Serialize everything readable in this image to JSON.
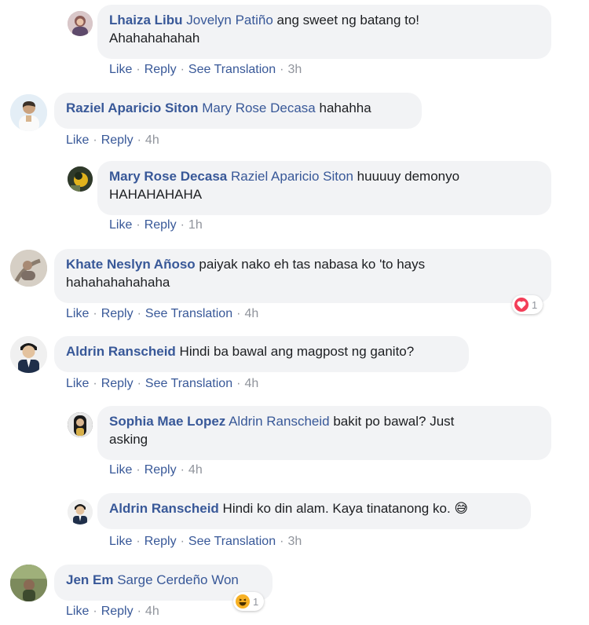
{
  "labels": {
    "like": "Like",
    "reply": "Reply",
    "see_translation": "See Translation",
    "separator": "·"
  },
  "comments": [
    {
      "author": "Lhaiza Libu",
      "mention": "Jovelyn Patiño",
      "text_line1": "ang sweet ng batang to!",
      "text_line2": "Ahahahahahah",
      "time": "3h"
    },
    {
      "author": "Raziel Aparicio Siton",
      "mention": "Mary Rose Decasa",
      "text": "hahahha",
      "time": "4h"
    },
    {
      "author": "Mary Rose Decasa",
      "mention": "Raziel Aparicio Siton",
      "text_line1": "huuuuy demonyo",
      "text_line2": "HAHAHAHAHA",
      "time": "1h"
    },
    {
      "author": "Khate Neslyn Añoso",
      "text_line1": "paiyak nako eh tas nabasa ko 'to hays",
      "text_line2": "hahahahahahaha",
      "time": "4h",
      "reaction_icon": "love-reaction-icon",
      "reaction_count": "1"
    },
    {
      "author": "Aldrin Ranscheid",
      "text": "Hindi ba bawal ang magpost ng ganito?",
      "time": "4h"
    },
    {
      "author": "Sophia Mae Lopez",
      "mention": "Aldrin Ranscheid",
      "text_line1": "bakit po bawal? Just",
      "text_line2": "asking",
      "time": "4h"
    },
    {
      "author": "Aldrin Ranscheid",
      "text": "Hindi ko din alam. Kaya tinatanong ko.",
      "emoji": "😅",
      "time": "3h"
    },
    {
      "author": "Jen Em",
      "mention": "Sarge Cerdeño Won",
      "time": "4h",
      "reaction_icon": "haha-reaction-icon",
      "reaction_count": "1"
    }
  ],
  "colors": {
    "link": "#385898",
    "meta": "#90949c",
    "bubble": "#f2f3f5",
    "love": "#f33e58",
    "haha": "#f7b125"
  }
}
